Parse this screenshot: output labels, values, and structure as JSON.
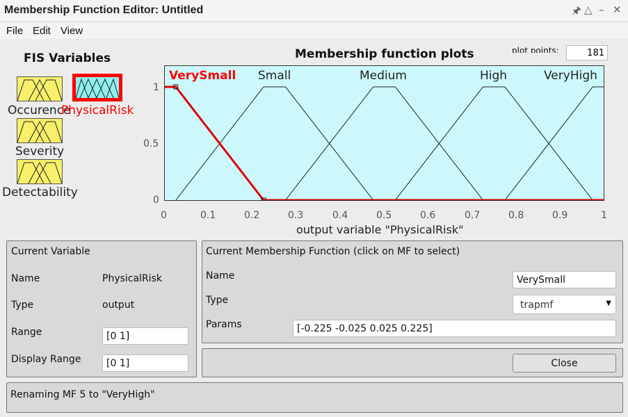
{
  "window": {
    "title": "Membership Function Editor: Untitled"
  },
  "menu": [
    "File",
    "Edit",
    "View"
  ],
  "fis": {
    "title": "FIS Variables",
    "variables": [
      {
        "name": "Occurence",
        "kind": "input",
        "selected": false
      },
      {
        "name": "PhysicalRisk",
        "kind": "output",
        "selected": true
      },
      {
        "name": "Severity",
        "kind": "input",
        "selected": false
      },
      {
        "name": "Detectability",
        "kind": "input",
        "selected": false
      }
    ]
  },
  "plot": {
    "title": "Membership function plots",
    "plot_points_label": "plot points:",
    "plot_points_value": "181",
    "xlabel": "output variable \"PhysicalRisk\""
  },
  "chart_data": {
    "type": "line",
    "title": "Membership function plots",
    "xlabel": "output variable \"PhysicalRisk\"",
    "ylabel": "",
    "xlim": [
      0,
      1
    ],
    "ylim": [
      0,
      1
    ],
    "x_ticks": [
      "0",
      "0.1",
      "0.2",
      "0.3",
      "0.4",
      "0.5",
      "0.6",
      "0.7",
      "0.8",
      "0.9",
      "1"
    ],
    "y_ticks": [
      "0",
      "0.5",
      "1"
    ],
    "selected_series": "VerySmall",
    "series": [
      {
        "name": "VerySmall",
        "x": [
          -0.225,
          -0.025,
          0.025,
          0.225
        ],
        "y": [
          0,
          1,
          1,
          0
        ]
      },
      {
        "name": "Small",
        "x": [
          0.025,
          0.225,
          0.275,
          0.475
        ],
        "y": [
          0,
          1,
          1,
          0
        ]
      },
      {
        "name": "Medium",
        "x": [
          0.275,
          0.475,
          0.525,
          0.725
        ],
        "y": [
          0,
          1,
          1,
          0
        ]
      },
      {
        "name": "High",
        "x": [
          0.525,
          0.725,
          0.775,
          0.975
        ],
        "y": [
          0,
          1,
          1,
          0
        ]
      },
      {
        "name": "VeryHigh",
        "x": [
          0.775,
          0.975,
          1.025,
          1.225
        ],
        "y": [
          0,
          1,
          1,
          0
        ]
      }
    ],
    "colors": {
      "background": "#ccf8fb",
      "selected": "#e00000",
      "normal": "#222222"
    }
  },
  "current_variable": {
    "header": "Current Variable",
    "name_label": "Name",
    "name_value": "PhysicalRisk",
    "type_label": "Type",
    "type_value": "output",
    "range_label": "Range",
    "range_value": "[0 1]",
    "display_range_label": "Display Range",
    "display_range_value": "[0 1]"
  },
  "current_mf": {
    "header": "Current Membership Function (click on MF to select)",
    "name_label": "Name",
    "name_value": "VerySmall",
    "type_label": "Type",
    "type_value": "trapmf",
    "params_label": "Params",
    "params_value": "[-0.225 -0.025 0.025 0.225]"
  },
  "close_label": "Close",
  "status": "Renaming MF 5 to \"VeryHigh\""
}
